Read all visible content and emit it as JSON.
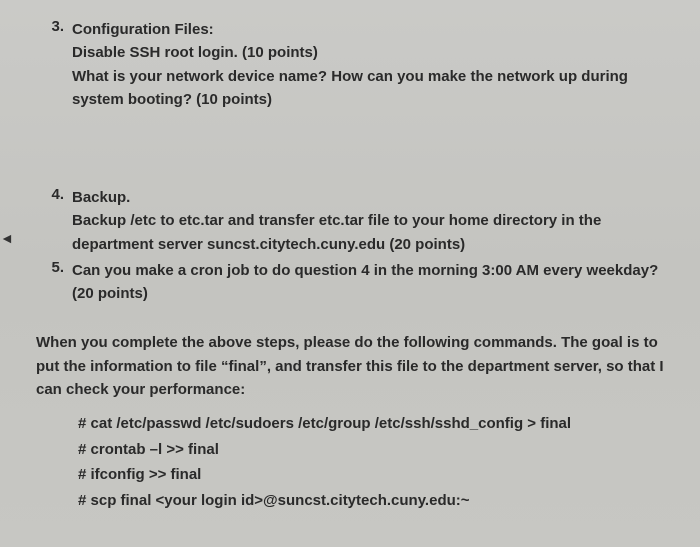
{
  "q3": {
    "num": "3.",
    "title": "Configuration Files:",
    "line1": "Disable SSH root login. (10 points)",
    "line2": "What is your network device name? How can you make the network up during system booting? (10 points)"
  },
  "q4": {
    "num": "4.",
    "title": "Backup.",
    "body": "Backup /etc to etc.tar and transfer etc.tar file to your home directory in the department server suncst.citytech.cuny.edu (20 points)"
  },
  "q5": {
    "num": "5.",
    "body": "Can you make a cron job to do question 4 in the morning 3:00 AM every weekday? (20 points)"
  },
  "closing": "When you complete the above steps, please do the following commands. The goal is to put the information to file “final”, and transfer this file to the department server, so that I can check your performance:",
  "cmds": {
    "c1": "# cat /etc/passwd  /etc/sudoers  /etc/group  /etc/ssh/sshd_config  > final",
    "c2": "#  crontab   –l  >>  final",
    "c3": "#  ifconfig  >>  final",
    "c4": "#  scp  final  <your login id>@suncst.citytech.cuny.edu:~"
  }
}
